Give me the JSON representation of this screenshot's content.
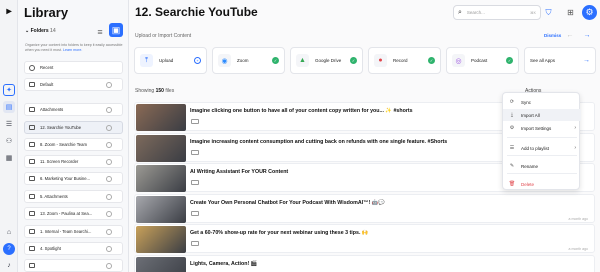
{
  "rail": {
    "icons": [
      "logo-icon",
      "sparkle-icon",
      "library-icon",
      "list-icon",
      "people-icon",
      "apps-icon",
      "graduation-icon",
      "help-icon",
      "bell-icon"
    ]
  },
  "library": {
    "title": "Library",
    "folders_label": "Folders",
    "folders_count": "14",
    "description": "Organize your content into folders to keep it easily accessible when you need it most.",
    "learn_more": "Learn more.",
    "items": [
      {
        "name": "Recent",
        "kind": "clock"
      },
      {
        "name": "Default",
        "kind": "folder"
      },
      {
        "name": "Attachments",
        "kind": "folder"
      },
      {
        "name": "12. Searchie YouTube",
        "kind": "folder",
        "selected": true
      },
      {
        "name": "8. Zoom - Searchie Team",
        "kind": "folder"
      },
      {
        "name": "11. Screen Recorder",
        "kind": "folder"
      },
      {
        "name": "6. Marketing Your Busine...",
        "kind": "folder"
      },
      {
        "name": "5. Attachments",
        "kind": "folder"
      },
      {
        "name": "13. Zoom - Paulina at Sea...",
        "kind": "folder"
      },
      {
        "name": "1. Internal - Team Searchi...",
        "kind": "folder"
      },
      {
        "name": "4. Spotlight",
        "kind": "folder"
      },
      {
        "name": "",
        "kind": "folder"
      }
    ]
  },
  "header": {
    "title": "12. Searchie YouTube",
    "search_placeholder": "Search...",
    "search_shortcut": "⌘K"
  },
  "upload": {
    "label": "Upload or Import Content",
    "dismiss": "Dismiss",
    "cards": [
      {
        "label": "Upload",
        "color": "#2b6fff"
      },
      {
        "label": "Zoom",
        "color": "#2d8cff"
      },
      {
        "label": "Google Drive",
        "color": "#34a853"
      },
      {
        "label": "Record",
        "color": "#e0454b"
      },
      {
        "label": "Podcast",
        "color": "#9b51e0"
      },
      {
        "label": "See all Apps",
        "color": "#2b6fff"
      }
    ]
  },
  "list": {
    "showing_prefix": "Showing",
    "count": "150",
    "suffix": "files",
    "actions_label": "Actions",
    "rows": [
      {
        "title": "Imagine clicking one button to have all of your content copy written for you... ✨ #shorts",
        "time": "",
        "thumb": "#8a6a55"
      },
      {
        "title": "Imagine increasing content consumption and cutting back on refunds with one single feature. #Shorts",
        "time": "",
        "thumb": "#7d6a5c"
      },
      {
        "title": "AI Writing Assistant For YOUR Content",
        "time": "",
        "thumb": "#9c9a94"
      },
      {
        "title": "Create Your Own Personal Chatbot For Your Podcast With WisdomAI™! 🤖💬",
        "time": "a month ago",
        "thumb": "#a7a8ad"
      },
      {
        "title": "Get a 60-70% show-up rate for your next webinar using these 3 tips. 🙌",
        "time": "a month ago",
        "thumb": "#c9a15a"
      },
      {
        "title": "Lights, Camera, Action! 🎬",
        "time": "",
        "thumb": "#6c6f76"
      }
    ]
  },
  "menu": {
    "items": [
      {
        "label": "Sync",
        "icon": "sync-icon",
        "glyph": "⟳"
      },
      {
        "label": "Import All",
        "icon": "import-icon",
        "glyph": "⤓"
      },
      {
        "label": "Import Settings",
        "icon": "import-settings-icon",
        "glyph": "⚙",
        "arrow": true
      },
      {
        "label": "Add to playlist",
        "icon": "playlist-icon",
        "glyph": "☰",
        "arrow": true
      },
      {
        "label": "Rename",
        "icon": "rename-icon",
        "glyph": "✎"
      },
      {
        "label": "Delete",
        "icon": "trash-icon",
        "glyph": "🗑",
        "danger": true
      }
    ]
  },
  "colors": {
    "accent": "#2b6fff",
    "success": "#2fb36d",
    "danger": "#e0454b"
  }
}
